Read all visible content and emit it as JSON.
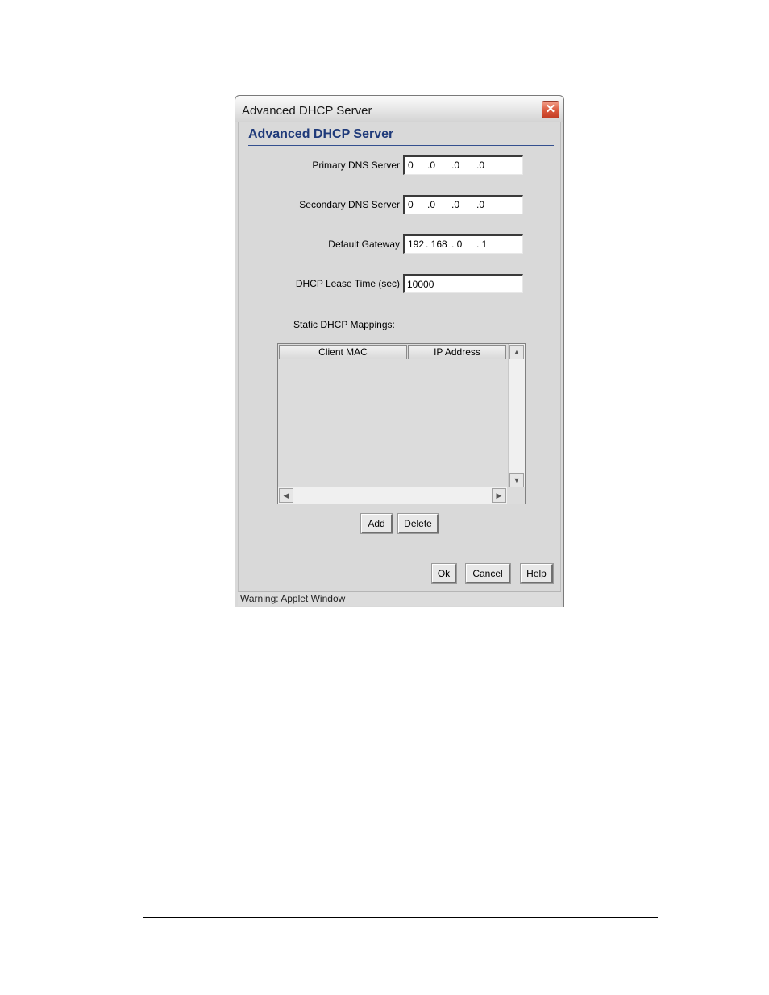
{
  "window": {
    "title": "Advanced DHCP Server",
    "close_glyph": "✕"
  },
  "header": {
    "title": "Advanced DHCP Server"
  },
  "fields": {
    "primary_dns": {
      "label": "Primary DNS Server",
      "octets": [
        "0",
        ".0",
        ".0",
        ".0"
      ]
    },
    "secondary_dns": {
      "label": "Secondary DNS Server",
      "octets": [
        "0",
        ".0",
        ".0",
        ".0"
      ]
    },
    "default_gateway": {
      "label": "Default Gateway",
      "octets": [
        "192",
        ". 168",
        ". 0",
        ". 1"
      ]
    },
    "lease_time": {
      "label": "DHCP Lease Time (sec)",
      "value": "10000"
    }
  },
  "mappings": {
    "label": "Static DHCP Mappings:",
    "columns": [
      "Client MAC",
      "IP Address"
    ],
    "rows": []
  },
  "buttons": {
    "add": "Add",
    "delete": "Delete",
    "ok": "Ok",
    "cancel": "Cancel",
    "help": "Help"
  },
  "status": {
    "text": "Warning: Applet Window"
  },
  "icons": {
    "scroll_up": "▲",
    "scroll_down": "▼",
    "scroll_left": "◀",
    "scroll_right": "▶"
  }
}
